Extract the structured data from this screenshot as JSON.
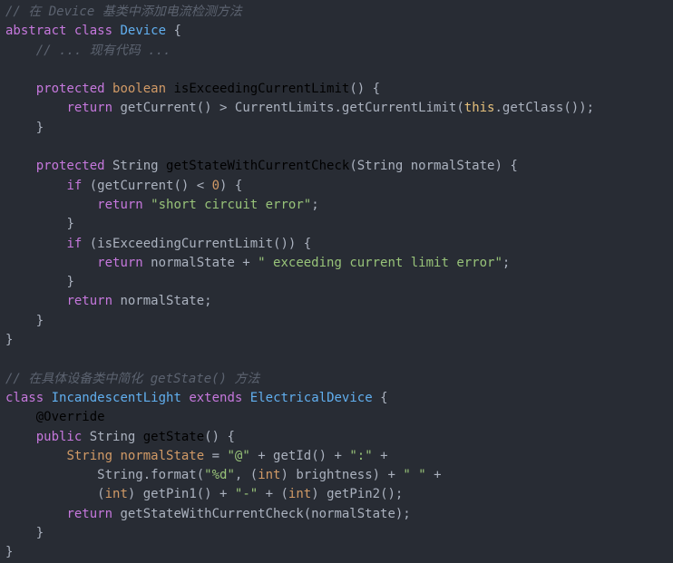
{
  "editor": {
    "language": "java",
    "theme": "one-dark",
    "background_color": "#282c34",
    "colors": {
      "plain": "#abb2bf",
      "comment": "#5c6370",
      "keyword": "#c678dd",
      "type": "#d19a66",
      "function": "#61afef",
      "string": "#98c379",
      "number": "#d19a66",
      "this": "#e5c07b",
      "annotation": "#61afef"
    },
    "lines": [
      {
        "n": 1,
        "indent": 0,
        "tokens": [
          {
            "t": "// 在 Device 基类中添加电流检测方法",
            "c": "comment"
          }
        ]
      },
      {
        "n": 2,
        "indent": 0,
        "tokens": [
          {
            "t": "abstract",
            "c": "keyword"
          },
          {
            "t": " ",
            "c": "plain"
          },
          {
            "t": "class",
            "c": "keyword"
          },
          {
            "t": " ",
            "c": "plain"
          },
          {
            "t": "Device",
            "c": "classname"
          },
          {
            "t": " {",
            "c": "plain"
          }
        ]
      },
      {
        "n": 3,
        "indent": 1,
        "tokens": [
          {
            "t": "// ... 现有代码 ...",
            "c": "comment"
          }
        ]
      },
      {
        "n": 4,
        "indent": 0,
        "tokens": [
          {
            "t": "",
            "c": "plain"
          }
        ]
      },
      {
        "n": 5,
        "indent": 1,
        "tokens": [
          {
            "t": "protected",
            "c": "keyword"
          },
          {
            "t": " ",
            "c": "plain"
          },
          {
            "t": "boolean",
            "c": "type"
          },
          {
            "t": " ",
            "c": "plain"
          },
          {
            "t": "isExceedingCurrentLimit",
            "c": "function"
          },
          {
            "t": "() {",
            "c": "plain"
          }
        ]
      },
      {
        "n": 6,
        "indent": 2,
        "tokens": [
          {
            "t": "return",
            "c": "keyword"
          },
          {
            "t": " getCurrent() ",
            "c": "plain"
          },
          {
            "t": ">",
            "c": "plain"
          },
          {
            "t": " CurrentLimits.getCurrentLimit(",
            "c": "plain"
          },
          {
            "t": "this",
            "c": "this"
          },
          {
            "t": ".getClass());",
            "c": "plain"
          }
        ]
      },
      {
        "n": 7,
        "indent": 1,
        "tokens": [
          {
            "t": "}",
            "c": "plain"
          }
        ]
      },
      {
        "n": 8,
        "indent": 0,
        "tokens": [
          {
            "t": "",
            "c": "plain"
          }
        ]
      },
      {
        "n": 9,
        "indent": 1,
        "tokens": [
          {
            "t": "protected",
            "c": "keyword"
          },
          {
            "t": " String ",
            "c": "plain"
          },
          {
            "t": "getStateWithCurrentCheck",
            "c": "function"
          },
          {
            "t": "(String normalState) {",
            "c": "plain"
          }
        ]
      },
      {
        "n": 10,
        "indent": 2,
        "tokens": [
          {
            "t": "if",
            "c": "keyword"
          },
          {
            "t": " (getCurrent() < ",
            "c": "plain"
          },
          {
            "t": "0",
            "c": "number"
          },
          {
            "t": ") {",
            "c": "plain"
          }
        ]
      },
      {
        "n": 11,
        "indent": 3,
        "tokens": [
          {
            "t": "return",
            "c": "keyword"
          },
          {
            "t": " ",
            "c": "plain"
          },
          {
            "t": "\"short circuit error\"",
            "c": "string"
          },
          {
            "t": ";",
            "c": "plain"
          }
        ]
      },
      {
        "n": 12,
        "indent": 2,
        "tokens": [
          {
            "t": "}",
            "c": "plain"
          }
        ]
      },
      {
        "n": 13,
        "indent": 2,
        "tokens": [
          {
            "t": "if",
            "c": "keyword"
          },
          {
            "t": " (isExceedingCurrentLimit()) {",
            "c": "plain"
          }
        ]
      },
      {
        "n": 14,
        "indent": 3,
        "tokens": [
          {
            "t": "return",
            "c": "keyword"
          },
          {
            "t": " normalState + ",
            "c": "plain"
          },
          {
            "t": "\" exceeding current limit error\"",
            "c": "string"
          },
          {
            "t": ";",
            "c": "plain"
          }
        ]
      },
      {
        "n": 15,
        "indent": 2,
        "tokens": [
          {
            "t": "}",
            "c": "plain"
          }
        ]
      },
      {
        "n": 16,
        "indent": 2,
        "tokens": [
          {
            "t": "return",
            "c": "keyword"
          },
          {
            "t": " normalState;",
            "c": "plain"
          }
        ]
      },
      {
        "n": 17,
        "indent": 1,
        "tokens": [
          {
            "t": "}",
            "c": "plain"
          }
        ]
      },
      {
        "n": 18,
        "indent": 0,
        "tokens": [
          {
            "t": "}",
            "c": "plain"
          }
        ]
      },
      {
        "n": 19,
        "indent": 0,
        "tokens": [
          {
            "t": "",
            "c": "plain"
          }
        ]
      },
      {
        "n": 20,
        "indent": 0,
        "tokens": [
          {
            "t": "// 在具体设备类中简化 getState() 方法",
            "c": "comment"
          }
        ]
      },
      {
        "n": 21,
        "indent": 0,
        "tokens": [
          {
            "t": "class",
            "c": "keyword"
          },
          {
            "t": " ",
            "c": "plain"
          },
          {
            "t": "IncandescentLight",
            "c": "classname"
          },
          {
            "t": " ",
            "c": "plain"
          },
          {
            "t": "extends",
            "c": "keyword"
          },
          {
            "t": " ",
            "c": "plain"
          },
          {
            "t": "ElectricalDevice",
            "c": "classname"
          },
          {
            "t": " {",
            "c": "plain"
          }
        ]
      },
      {
        "n": 22,
        "indent": 1,
        "tokens": [
          {
            "t": "@Override",
            "c": "annotation"
          }
        ]
      },
      {
        "n": 23,
        "indent": 1,
        "tokens": [
          {
            "t": "public",
            "c": "keyword"
          },
          {
            "t": " String ",
            "c": "plain"
          },
          {
            "t": "getState",
            "c": "function"
          },
          {
            "t": "() {",
            "c": "plain"
          }
        ]
      },
      {
        "n": 24,
        "indent": 2,
        "tokens": [
          {
            "t": "String",
            "c": "type"
          },
          {
            "t": " ",
            "c": "plain"
          },
          {
            "t": "normalState",
            "c": "type"
          },
          {
            "t": " = ",
            "c": "plain"
          },
          {
            "t": "\"@\"",
            "c": "string"
          },
          {
            "t": " + getId() + ",
            "c": "plain"
          },
          {
            "t": "\":\"",
            "c": "string"
          },
          {
            "t": " +",
            "c": "plain"
          }
        ]
      },
      {
        "n": 25,
        "indent": 3,
        "tokens": [
          {
            "t": "String.format(",
            "c": "plain"
          },
          {
            "t": "\"%d\"",
            "c": "string"
          },
          {
            "t": ", (",
            "c": "plain"
          },
          {
            "t": "int",
            "c": "type"
          },
          {
            "t": ") brightness) + ",
            "c": "plain"
          },
          {
            "t": "\" \"",
            "c": "string"
          },
          {
            "t": " +",
            "c": "plain"
          }
        ]
      },
      {
        "n": 26,
        "indent": 3,
        "tokens": [
          {
            "t": "(",
            "c": "plain"
          },
          {
            "t": "int",
            "c": "type"
          },
          {
            "t": ") getPin1() + ",
            "c": "plain"
          },
          {
            "t": "\"-\"",
            "c": "string"
          },
          {
            "t": " + (",
            "c": "plain"
          },
          {
            "t": "int",
            "c": "type"
          },
          {
            "t": ") getPin2();",
            "c": "plain"
          }
        ]
      },
      {
        "n": 27,
        "indent": 2,
        "tokens": [
          {
            "t": "return",
            "c": "keyword"
          },
          {
            "t": " getStateWithCurrentCheck(normalState);",
            "c": "plain"
          }
        ]
      },
      {
        "n": 28,
        "indent": 1,
        "tokens": [
          {
            "t": "}",
            "c": "plain"
          }
        ]
      },
      {
        "n": 29,
        "indent": 0,
        "tokens": [
          {
            "t": "}",
            "c": "plain"
          }
        ]
      }
    ]
  }
}
